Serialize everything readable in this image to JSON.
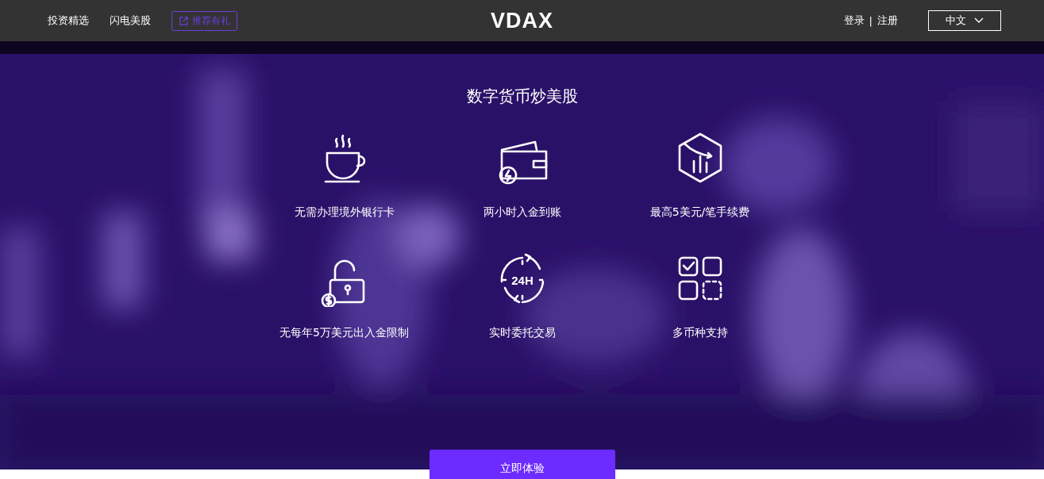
{
  "header": {
    "nav": [
      {
        "label": "投资精选"
      },
      {
        "label": "闪电美股"
      }
    ],
    "promo": {
      "label": "推荐有礼"
    },
    "logo": "VDAX",
    "auth": {
      "login": "登录",
      "separator": "|",
      "register": "注册"
    },
    "language": {
      "label": "中文"
    }
  },
  "hero": {
    "title": "数字货币炒美股",
    "features": [
      {
        "kind": "cup",
        "label": "无需办理境外银行卡"
      },
      {
        "kind": "wallet",
        "label": "两小时入金到账"
      },
      {
        "kind": "hexchart",
        "label": "最高5美元/笔手续费"
      },
      {
        "kind": "lock",
        "label": "无每年5万美元出入金限制"
      },
      {
        "kind": "clock",
        "label": "实时委托交易",
        "icon_text": "24H"
      },
      {
        "kind": "grid",
        "label": "多币种支持"
      }
    ],
    "cta": "立即体验"
  }
}
